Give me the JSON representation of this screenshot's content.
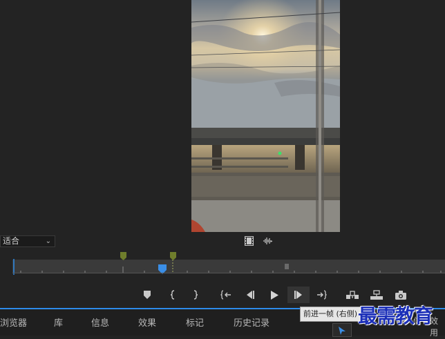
{
  "monitor": {
    "fit_label": "适合"
  },
  "tooltip": {
    "text": "前进一帧 (右侧)"
  },
  "tabs": [
    {
      "label": "浏览器"
    },
    {
      "label": "库"
    },
    {
      "label": "信息"
    },
    {
      "label": "效果"
    },
    {
      "label": "标记"
    },
    {
      "label": "历史记录"
    }
  ],
  "cut_text_left": "信",
  "cut_text_right": "效用",
  "watermark": "最需教育",
  "transport_icons": [
    "add-marker-icon",
    "mark-in-icon",
    "mark-out-icon",
    "go-to-in-icon",
    "step-back-icon",
    "play-icon",
    "step-forward-icon",
    "go-to-out-icon",
    "insert-icon",
    "overwrite-icon",
    "export-frame-icon"
  ],
  "colors": {
    "accent": "#2d8ceb",
    "playhead": "#3a8ee6",
    "marker_green": "#6f7d2c"
  }
}
